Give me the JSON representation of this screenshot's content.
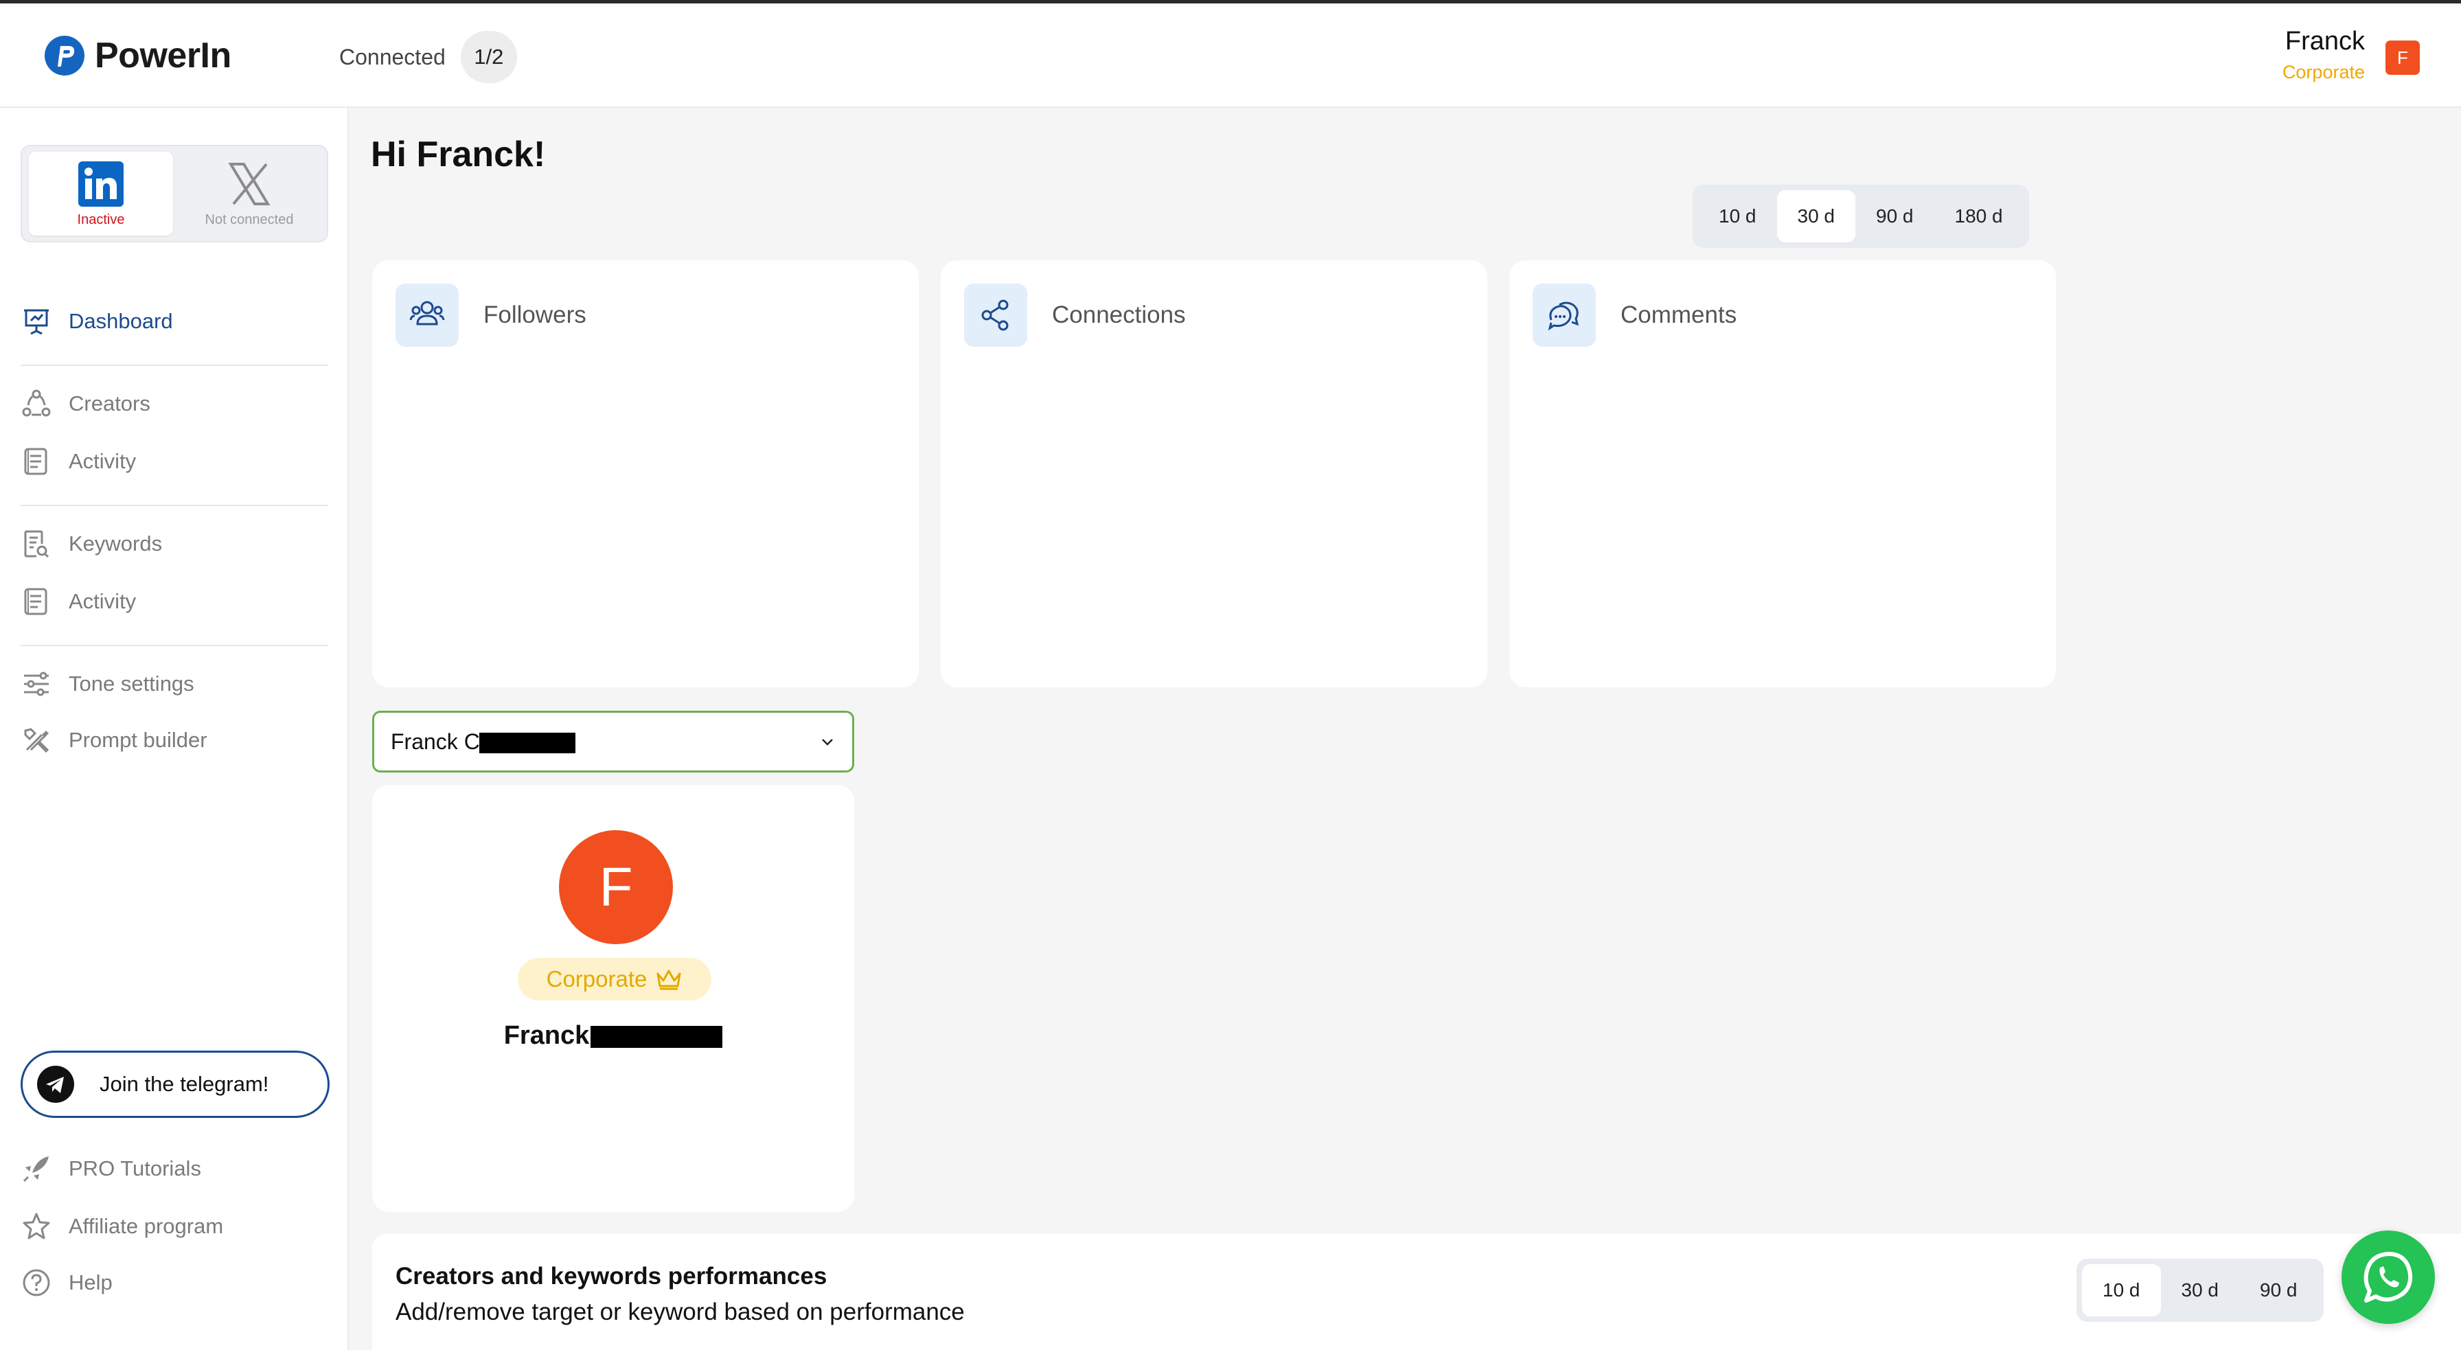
{
  "app": {
    "name": "PowerIn"
  },
  "header": {
    "connected_label": "Connected",
    "connected_count": "1/2",
    "user_name": "Franck",
    "user_plan": "Corporate",
    "user_initial": "F"
  },
  "networks": [
    {
      "name": "linkedin",
      "status": "Inactive"
    },
    {
      "name": "x",
      "status": "Not connected"
    }
  ],
  "sidebar": {
    "items": [
      {
        "label": "Dashboard",
        "icon": "presentation-icon"
      },
      {
        "label": "Creators",
        "icon": "users-circle-icon"
      },
      {
        "label": "Activity",
        "icon": "document-icon"
      },
      {
        "label": "Keywords",
        "icon": "document-search-icon"
      },
      {
        "label": "Activity",
        "icon": "document-icon"
      },
      {
        "label": "Tone settings",
        "icon": "sliders-icon"
      },
      {
        "label": "Prompt builder",
        "icon": "tools-icon"
      }
    ],
    "telegram_label": "Join the telegram!",
    "footer_items": [
      {
        "label": "PRO Tutorials",
        "icon": "rocket-icon"
      },
      {
        "label": "Affiliate program",
        "icon": "star-icon"
      },
      {
        "label": "Help",
        "icon": "help-icon"
      }
    ]
  },
  "main": {
    "greeting": "Hi Franck!",
    "ranges": [
      "10 d",
      "30 d",
      "90 d",
      "180 d"
    ],
    "selected_range": "30 d",
    "stats": [
      {
        "title": "Followers",
        "icon": "followers-icon"
      },
      {
        "title": "Connections",
        "icon": "share-icon"
      },
      {
        "title": "Comments",
        "icon": "chat-icon"
      }
    ],
    "account_select": {
      "value": "Franck C"
    },
    "profile": {
      "initial": "F",
      "plan": "Corporate",
      "name": "Franck"
    },
    "performance": {
      "title": "Creators and keywords performances",
      "subtitle": "Add/remove target or keyword based on performance",
      "ranges": [
        "10 d",
        "30 d",
        "90 d"
      ],
      "selected_range": "10 d"
    }
  },
  "colors": {
    "accent": "#1c4b8d",
    "plan": "#f0a800",
    "avatar": "#f14f1f",
    "linkedin": "#0a66c2",
    "whatsapp": "#25c255"
  }
}
